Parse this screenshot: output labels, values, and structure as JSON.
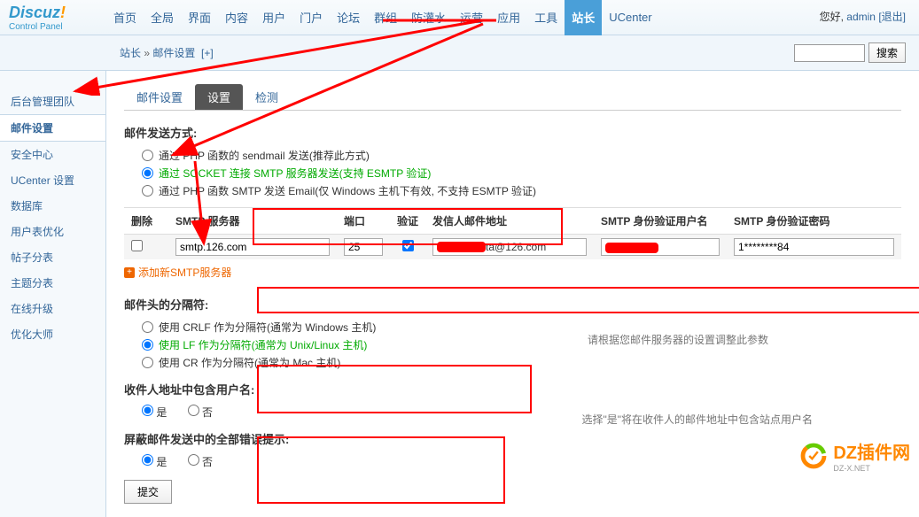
{
  "header": {
    "logo_main": "Discuz",
    "logo_sub": "Control Panel",
    "nav": [
      "首页",
      "全局",
      "界面",
      "内容",
      "用户",
      "门户",
      "论坛",
      "群组",
      "防灌水",
      "运营",
      "应用",
      "工具",
      "站长",
      "UCenter"
    ],
    "nav_active_index": 12,
    "greeting": "您好,",
    "username": "admin",
    "logout": "[退出]"
  },
  "breadcrumb": {
    "root": "站长",
    "sep": " » ",
    "page": "邮件设置",
    "plus": "[+]",
    "search_btn": "搜索"
  },
  "sidebar": {
    "items": [
      "后台管理团队",
      "邮件设置",
      "安全中心",
      "UCenter 设置",
      "数据库",
      "用户表优化",
      "帖子分表",
      "主题分表",
      "在线升级",
      "优化大师"
    ],
    "active_index": 1
  },
  "tabs": {
    "items": [
      "邮件设置",
      "设置",
      "检测"
    ],
    "active_index": 1
  },
  "section1": {
    "title": "邮件发送方式:",
    "opts": [
      "通过 PHP 函数的 sendmail 发送(推荐此方式)",
      "通过 SOCKET 连接 SMTP 服务器发送(支持 ESMTP 验证)",
      "通过 PHP 函数 SMTP 发送 Email(仅 Windows 主机下有效, 不支持 ESMTP 验证)"
    ]
  },
  "smtp": {
    "headers": [
      "删除",
      "SMTP 服务器",
      "端口",
      "验证",
      "发信人邮件地址",
      "SMTP 身份验证用户名",
      "SMTP 身份验证密码"
    ],
    "row": {
      "server": "smtp.126.com",
      "port": "25",
      "email_suffix": "ta@126.com",
      "password": "1********84"
    },
    "add_text": "添加新SMTP服务器"
  },
  "section2": {
    "title": "邮件头的分隔符:",
    "opts": [
      "使用 CRLF 作为分隔符(通常为 Windows 主机)",
      "使用 LF 作为分隔符(通常为 Unix/Linux 主机)",
      "使用 CR 作为分隔符(通常为 Mac 主机)"
    ],
    "desc": "请根据您邮件服务器的设置调整此参数"
  },
  "section3": {
    "title": "收件人地址中包含用户名:",
    "yes": "是",
    "no": "否",
    "desc": "选择\"是\"将在收件人的邮件地址中包含站点用户名"
  },
  "section4": {
    "title": "屏蔽邮件发送中的全部错误提示:",
    "yes": "是",
    "no": "否"
  },
  "submit": "提交",
  "watermark": {
    "main": "DZ插件网",
    "sub": "DZ-X.NET"
  }
}
